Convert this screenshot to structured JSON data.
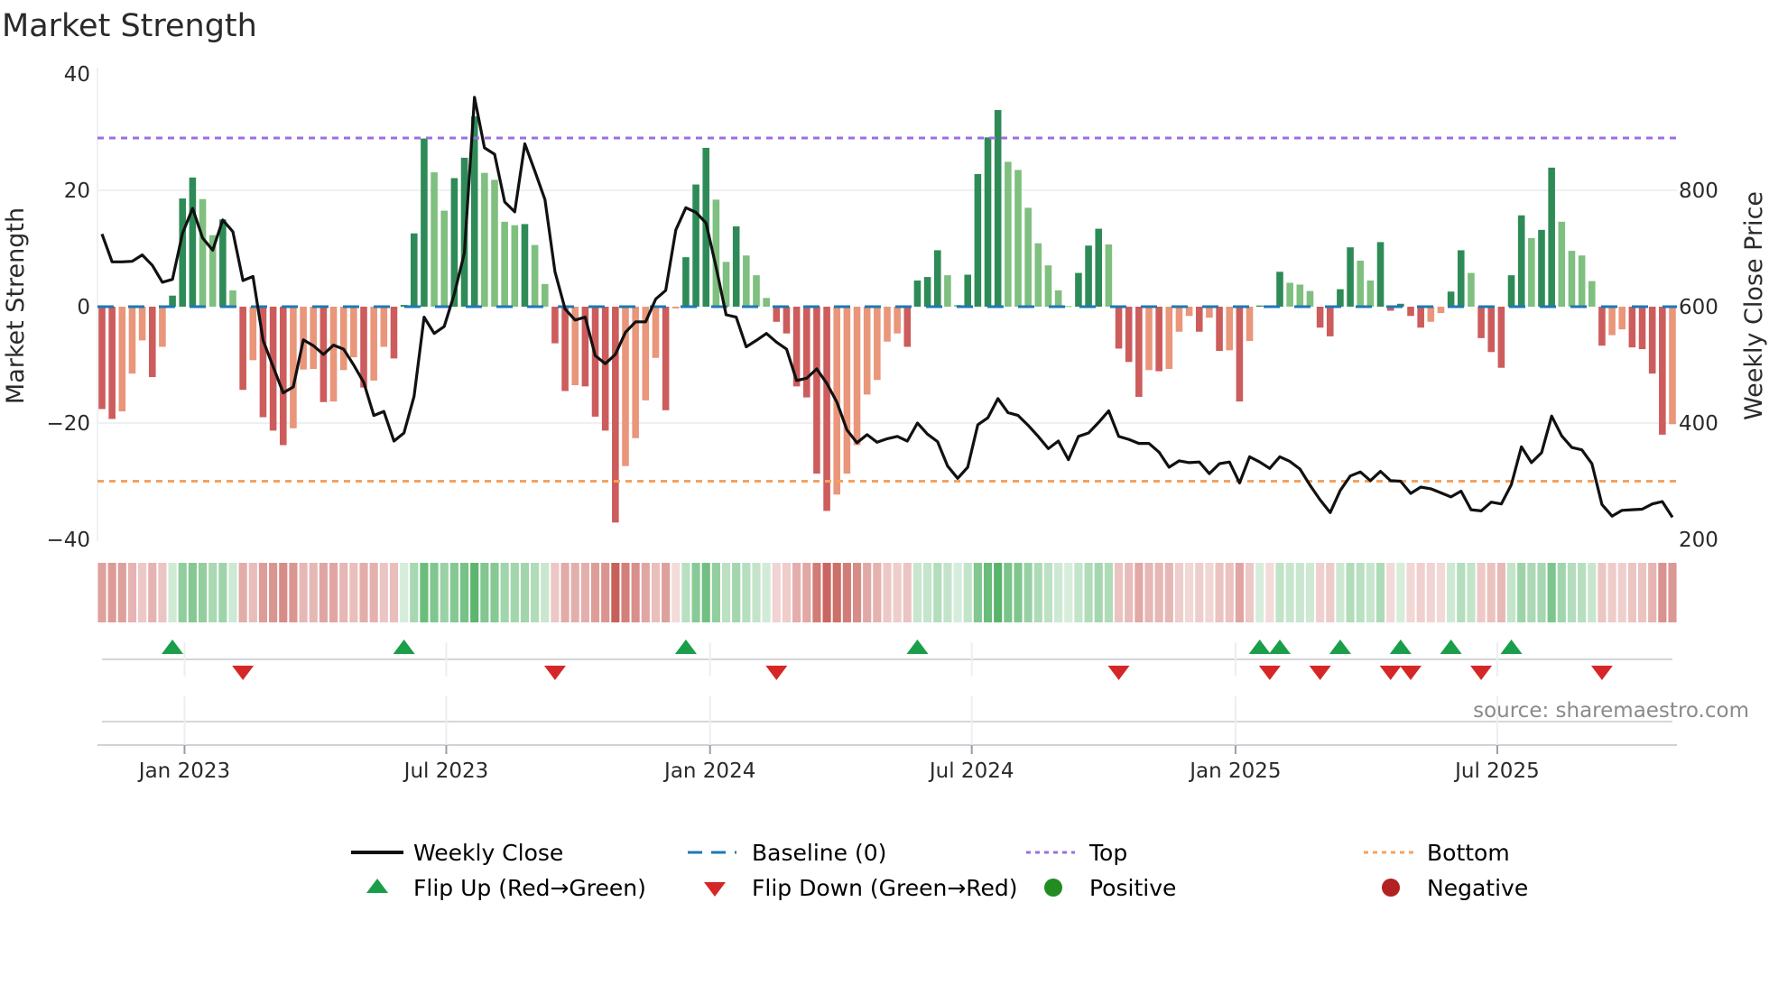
{
  "title": "Market Strength",
  "source": "source: sharemaestro.com",
  "colors": {
    "strong_green": "#2e8b57",
    "weak_green": "#7fbf7f",
    "strong_red": "#cd5c5c",
    "weak_red": "#e9967a",
    "baseline": "#1f77b4",
    "top": "#9b6fe0",
    "bottom": "#f4a261",
    "flip_up": "#1a9e4a",
    "flip_down": "#d62728",
    "positive": "#228b22",
    "negative": "#b22222",
    "heat_green": "#4caf60",
    "heat_red": "#c8605a",
    "line": "#111111"
  },
  "legend": [
    {
      "label": "Weekly Close",
      "icon": "solid-line"
    },
    {
      "label": "Baseline (0)",
      "icon": "dashed-line"
    },
    {
      "label": "Top",
      "icon": "dotted-purple-line"
    },
    {
      "label": "Bottom",
      "icon": "dotted-orange-line"
    },
    {
      "label": "Flip Up (Red→Green)",
      "icon": "triangle-up"
    },
    {
      "label": "Flip Down (Green→Red)",
      "icon": "triangle-down"
    },
    {
      "label": "Positive",
      "icon": "green-dot"
    },
    {
      "label": "Negative",
      "icon": "red-dot"
    }
  ],
  "chart_data": {
    "type": "bar",
    "title": "Market Strength",
    "ylabel": "Market Strength",
    "y2label": "Weekly Close Price",
    "ylim": [
      -40,
      40
    ],
    "y2lim": [
      200,
      1000
    ],
    "yticks": [
      -40,
      -20,
      0,
      20,
      40
    ],
    "y2ticks": [
      200,
      400,
      600,
      800
    ],
    "top_level": 29,
    "bottom_level": -30,
    "baseline": 0,
    "grid": true,
    "legend_position": "bottom",
    "x_unit": "week index",
    "xticks": [
      {
        "label": "Jan 2023",
        "week": 9.2
      },
      {
        "label": "Jul 2023",
        "week": 35.2
      },
      {
        "label": "Jan 2024",
        "week": 61.4
      },
      {
        "label": "Jul 2024",
        "week": 87.4
      },
      {
        "label": "Jan 2025",
        "week": 113.6
      },
      {
        "label": "Jul 2025",
        "week": 139.6
      }
    ],
    "series": [
      {
        "name": "Market Strength",
        "type": "bar",
        "values": [
          -17.6,
          -19.3,
          -18.0,
          -11.5,
          -5.8,
          -12.1,
          -6.9,
          1.9,
          18.6,
          22.2,
          18.5,
          12.3,
          15.0,
          2.8,
          -14.3,
          -9.2,
          -19.0,
          -21.3,
          -23.8,
          -20.9,
          -10.8,
          -10.7,
          -16.4,
          -16.3,
          -10.9,
          -8.7,
          -13.9,
          -12.7,
          -6.9,
          -8.9,
          0.3,
          12.6,
          28.9,
          23.1,
          16.5,
          22.1,
          25.6,
          32.7,
          23.0,
          21.8,
          14.6,
          14.0,
          14.2,
          10.6,
          3.9,
          -6.3,
          -14.5,
          -13.5,
          -13.7,
          -18.9,
          -21.3,
          -37.1,
          -27.4,
          -22.6,
          -16.1,
          -8.8,
          -17.8,
          -0.3,
          8.5,
          21.0,
          27.3,
          18.4,
          7.7,
          13.8,
          8.8,
          5.4,
          1.5,
          -2.6,
          -4.6,
          -13.7,
          -15.6,
          -28.7,
          -35.1,
          -32.3,
          -28.7,
          -23.8,
          -15.1,
          -12.6,
          -6.0,
          -4.6,
          -6.9,
          4.5,
          5.1,
          9.7,
          5.4,
          0.3,
          5.5,
          22.8,
          29.1,
          33.8,
          24.9,
          23.5,
          17.0,
          10.9,
          7.1,
          2.8,
          0.1,
          5.8,
          10.5,
          13.4,
          10.7,
          -7.2,
          -9.5,
          -15.5,
          -10.9,
          -11.1,
          -10.7,
          -4.3,
          -1.6,
          -4.3,
          -1.9,
          -7.6,
          -7.5,
          -16.3,
          -5.9,
          0.2,
          -0.2,
          6.0,
          4.1,
          3.8,
          2.7,
          -3.6,
          -5.1,
          3.0,
          10.2,
          7.9,
          4.5,
          11.1,
          -0.7,
          0.5,
          -1.6,
          -3.6,
          -2.6,
          -1.1,
          2.6,
          9.7,
          5.8,
          -5.4,
          -7.8,
          -10.5,
          5.4,
          15.7,
          11.8,
          13.2,
          23.9,
          14.6,
          9.6,
          8.8,
          4.4,
          -6.7,
          -4.9,
          -3.9,
          -7.0,
          -7.3,
          -11.5,
          -22.0,
          -20.2
        ]
      },
      {
        "name": "Weekly Close",
        "type": "line",
        "axis": "right",
        "values": [
          725,
          677,
          677,
          678,
          689,
          671,
          642,
          647,
          726,
          769,
          718,
          697,
          749,
          729,
          645,
          652,
          542,
          497,
          452,
          462,
          543,
          533,
          518,
          534,
          527,
          500,
          470,
          413,
          420,
          369,
          383,
          446,
          582,
          554,
          566,
          622,
          692,
          960,
          873,
          862,
          780,
          763,
          880,
          833,
          784,
          660,
          596,
          577,
          582,
          516,
          502,
          518,
          556,
          574,
          574,
          613,
          628,
          732,
          770,
          762,
          744,
          668,
          586,
          582,
          531,
          542,
          554,
          539,
          527,
          473,
          477,
          493,
          468,
          436,
          388,
          366,
          380,
          367,
          373,
          377,
          369,
          400,
          381,
          368,
          326,
          305,
          324,
          397,
          409,
          442,
          418,
          413,
          396,
          377,
          356,
          369,
          337,
          377,
          383,
          401,
          421,
          377,
          372,
          365,
          365,
          350,
          324,
          335,
          332,
          333,
          313,
          330,
          333,
          297,
          342,
          333,
          322,
          342,
          334,
          321,
          293,
          268,
          246,
          284,
          309,
          316,
          301,
          317,
          301,
          300,
          279,
          290,
          287,
          280,
          273,
          283,
          251,
          249,
          264,
          261,
          294,
          359,
          332,
          349,
          412,
          378,
          358,
          354,
          330,
          260,
          240,
          250,
          251,
          252,
          261,
          265,
          238
        ]
      }
    ],
    "flip_up_weeks": [
      8,
      31,
      59,
      82,
      116,
      118,
      124,
      130,
      135,
      141
    ],
    "flip_down_weeks": [
      15,
      46,
      68,
      102,
      117,
      122,
      129,
      131,
      138,
      150
    ]
  }
}
